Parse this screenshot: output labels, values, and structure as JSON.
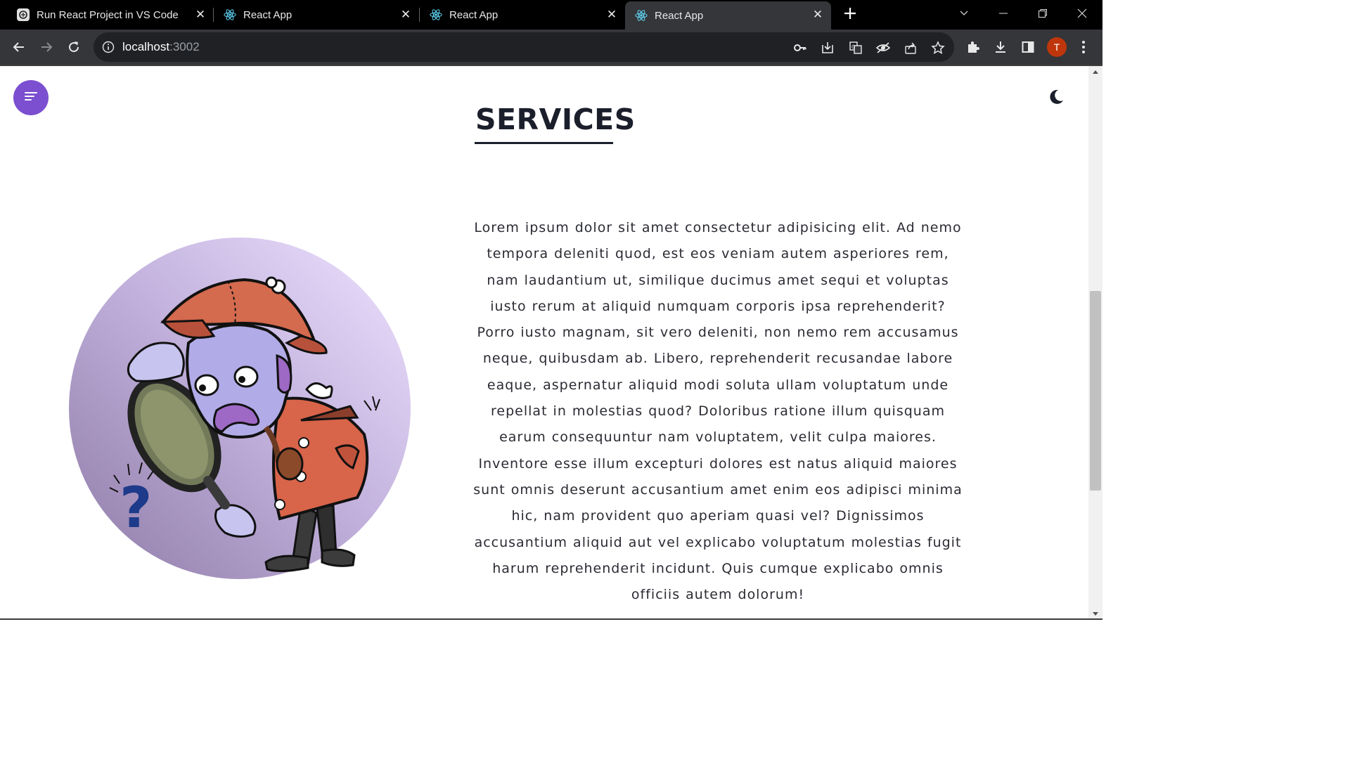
{
  "browser": {
    "tabs": [
      {
        "title": "Run React Project in VS Code",
        "icon": "chatgpt-icon",
        "active": false
      },
      {
        "title": "React App",
        "icon": "react-icon",
        "active": false
      },
      {
        "title": "React App",
        "icon": "react-icon",
        "active": false
      },
      {
        "title": "React App",
        "icon": "react-icon",
        "active": true
      }
    ],
    "address": {
      "host": "localhost",
      "port": ":3002"
    },
    "profile_initial": "T",
    "colors": {
      "tabbar": "#000000",
      "toolbar": "#35363a",
      "omnibox": "#202124",
      "avatar": "#c0360c"
    }
  },
  "page": {
    "title": "SERVICES",
    "paragraph": "Lorem ipsum dolor sit amet consectetur adipisicing elit. Ad nemo tempora deleniti quod, est eos veniam autem asperiores rem, nam laudantium ut, similique ducimus amet sequi et voluptas iusto rerum at aliquid numquam corporis ipsa reprehenderit? Porro iusto magnam, sit vero deleniti, non nemo rem accusamus neque, quibusdam ab. Libero, reprehenderit recusandae labore eaque, aspernatur aliquid modi soluta ullam voluptatum unde repellat in molestias quod? Doloribus ratione illum quisquam earum consequuntur nam voluptatem, velit culpa maiores. Inventore esse illum excepturi dolores est natus aliquid maiores sunt omnis deserunt accusantium amet enim eos adipisci minima hic, nam provident quo aperiam quasi vel? Dignissimos accusantium aliquid aut vel explicabo voluptatum molestias fugit harum reprehenderit incidunt. Quis cumque explicabo omnis officiis autem dolorum!",
    "menu_icon": "menu-lines-icon",
    "theme_icon": "moon-icon",
    "illustration": "detective-with-magnifying-glass",
    "colors": {
      "accent": "#7b4fd0",
      "text": "#1b1e2b"
    }
  }
}
